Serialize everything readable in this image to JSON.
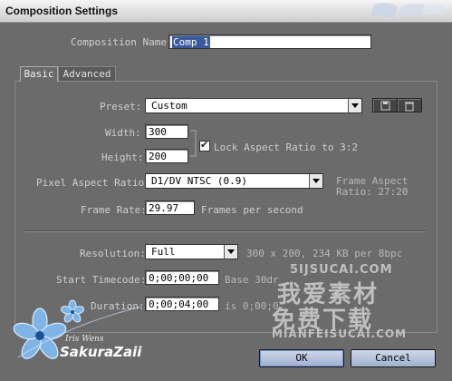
{
  "window": {
    "title": "Composition Settings"
  },
  "composition_name": {
    "label": "Composition Name:",
    "value": "Comp 1"
  },
  "tabs": [
    {
      "label": "Basic"
    },
    {
      "label": "Advanced"
    }
  ],
  "preset": {
    "label": "Preset:",
    "value": "Custom"
  },
  "width": {
    "label": "Width:",
    "value": "300"
  },
  "height": {
    "label": "Height:",
    "value": "200"
  },
  "lock_aspect": {
    "label": "Lock Aspect Ratio to 3:2",
    "checked": true
  },
  "pixel_aspect": {
    "label": "Pixel Aspect Ratio:",
    "value": "D1/DV NTSC (0.9)",
    "frame_aspect_line1": "Frame Aspect",
    "frame_aspect_line2": "Ratio: 27:20"
  },
  "frame_rate": {
    "label": "Frame Rate:",
    "value": "29.97",
    "unit": "Frames per second"
  },
  "resolution": {
    "label": "Resolution:",
    "value": "Full",
    "info": "300 x 200, 234 KB per 8bpc"
  },
  "start_timecode": {
    "label": "Start Timecode:",
    "value": "0;00;00;00",
    "info": "Base 30dr"
  },
  "duration": {
    "label": "Duration:",
    "value": "0;00;04;00",
    "info": "is 0;00;0"
  },
  "buttons": {
    "ok": "OK",
    "cancel": "Cancel"
  },
  "watermark": {
    "site": "5IJSUCAI.COM",
    "cn1": "我爱素材",
    "cn2": "免费下载",
    "url": "MIANFEISUCAI.COM",
    "logo_small": "Iris Wens",
    "logo_text": "SakuraZaii"
  }
}
